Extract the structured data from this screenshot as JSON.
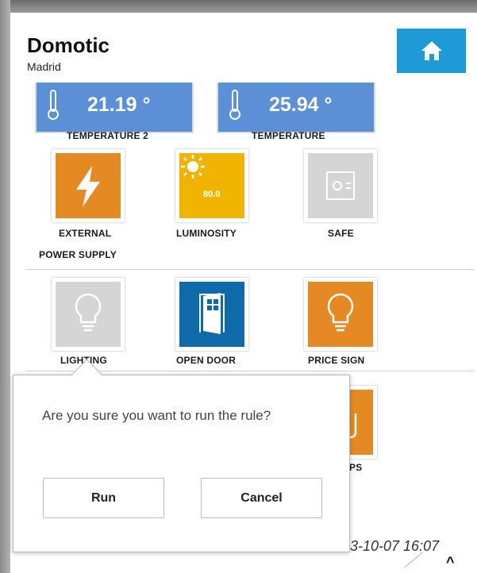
{
  "header": {
    "title": "Domotic",
    "subtitle": "Madrid",
    "home_icon": "home-icon"
  },
  "sensors": [
    {
      "value": "21.19 °",
      "label": "TEMPERATURE 2"
    },
    {
      "value": "25.94 °",
      "label": "TEMPERATURE"
    }
  ],
  "row1": [
    {
      "label_line1": "EXTERNAL",
      "label_line2": "POWER SUPPLY",
      "icon": "lightning-icon",
      "color": "#e58a22"
    },
    {
      "label": "LUMINOSITY",
      "value": "80.0",
      "icon": "sun-icon",
      "color": "#f0b400"
    },
    {
      "label": "SAFE",
      "icon": "safe-icon",
      "color": "#d5d5d5"
    }
  ],
  "row2": [
    {
      "label": "LIGHTING",
      "icon": "bulb-icon",
      "color": "#d5d5d5"
    },
    {
      "label": "OPEN DOOR",
      "icon": "door-icon",
      "color": "#0e6aa9"
    },
    {
      "label": "PRICE SIGN",
      "icon": "bulb-icon",
      "color": "#e58a22"
    }
  ],
  "partial_tile": {
    "label": "PS",
    "color": "#e58a22"
  },
  "dialog": {
    "message": "Are you sure you want to run the rule?",
    "run_label": "Run",
    "cancel_label": "Cancel"
  },
  "footer": {
    "datetime": "3-10-07 16:07",
    "caret": "^"
  }
}
